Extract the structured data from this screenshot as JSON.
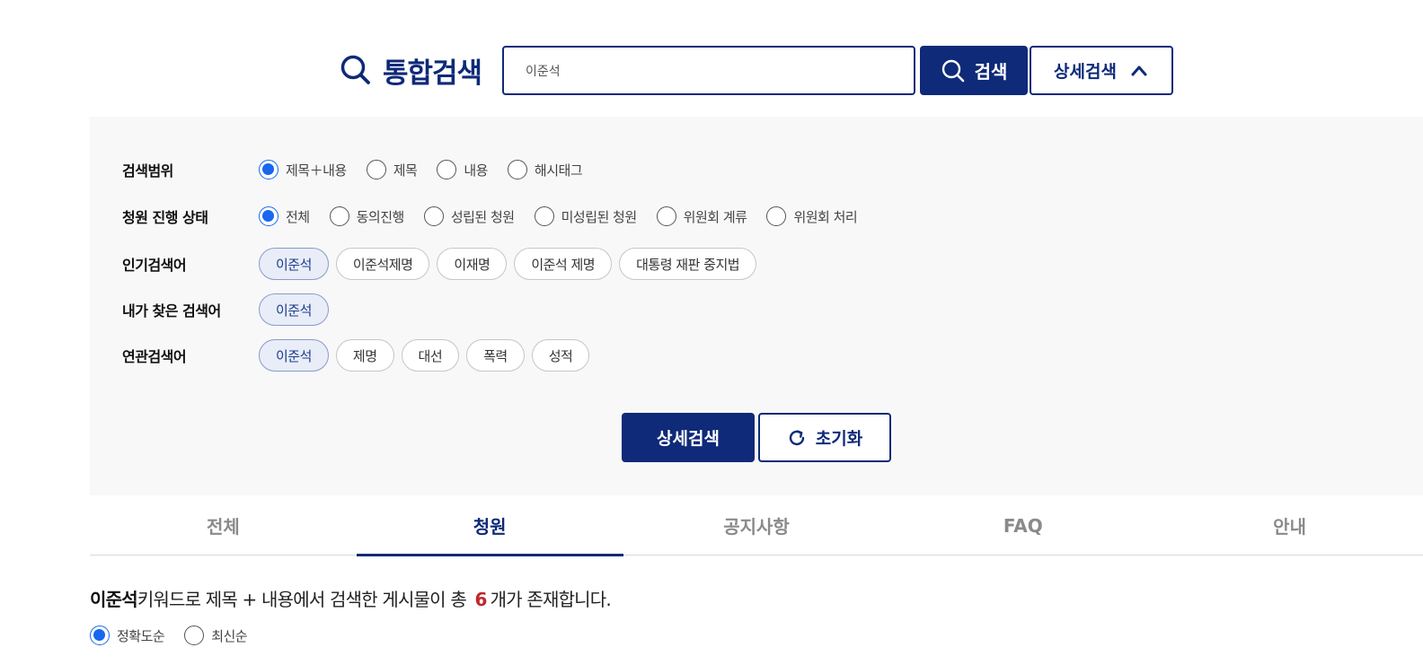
{
  "header": {
    "title": "통합검색",
    "search_value": "이준석",
    "search_button_label": "검색",
    "advanced_toggle_label": "상세검색"
  },
  "filters": {
    "scope": {
      "label": "검색범위",
      "options": [
        "제목＋내용",
        "제목",
        "내용",
        "해시태그"
      ],
      "selected": "제목＋내용"
    },
    "status": {
      "label": "청원 진행 상태",
      "options": [
        "전체",
        "동의진행",
        "성립된 청원",
        "미성립된 청원",
        "위원회 계류",
        "위원회 처리"
      ],
      "selected": "전체"
    },
    "popular": {
      "label": "인기검색어",
      "chips": [
        "이준석",
        "이준석제명",
        "이재명",
        "이준석 제명",
        "대통령 재판 중지법"
      ]
    },
    "my_searches": {
      "label": "내가 찾은 검색어",
      "chips": [
        "이준석"
      ]
    },
    "related": {
      "label": "연관검색어",
      "chips": [
        "이준석",
        "제명",
        "대선",
        "폭력",
        "성적"
      ]
    },
    "submit_label": "상세검색",
    "reset_label": "초기화"
  },
  "tabs": [
    {
      "label": "전체",
      "active": false
    },
    {
      "label": "청원",
      "active": true
    },
    {
      "label": "공지사항",
      "active": false
    },
    {
      "label": "FAQ",
      "active": false
    },
    {
      "label": "안내",
      "active": false
    }
  ],
  "results": {
    "keyword": "이준석",
    "text_before": "키워드로 제목 + 내용에서 검색한 게시물이 총",
    "count": "6",
    "text_after": "개가 존재합니다."
  },
  "sort": {
    "options": [
      "정확도순",
      "최신순"
    ],
    "selected": "정확도순"
  },
  "colors": {
    "brand": "#0e2a78",
    "radio_checked": "#1767f0",
    "count_highlight": "#c0272d",
    "panel_bg": "#f8f8f8"
  }
}
